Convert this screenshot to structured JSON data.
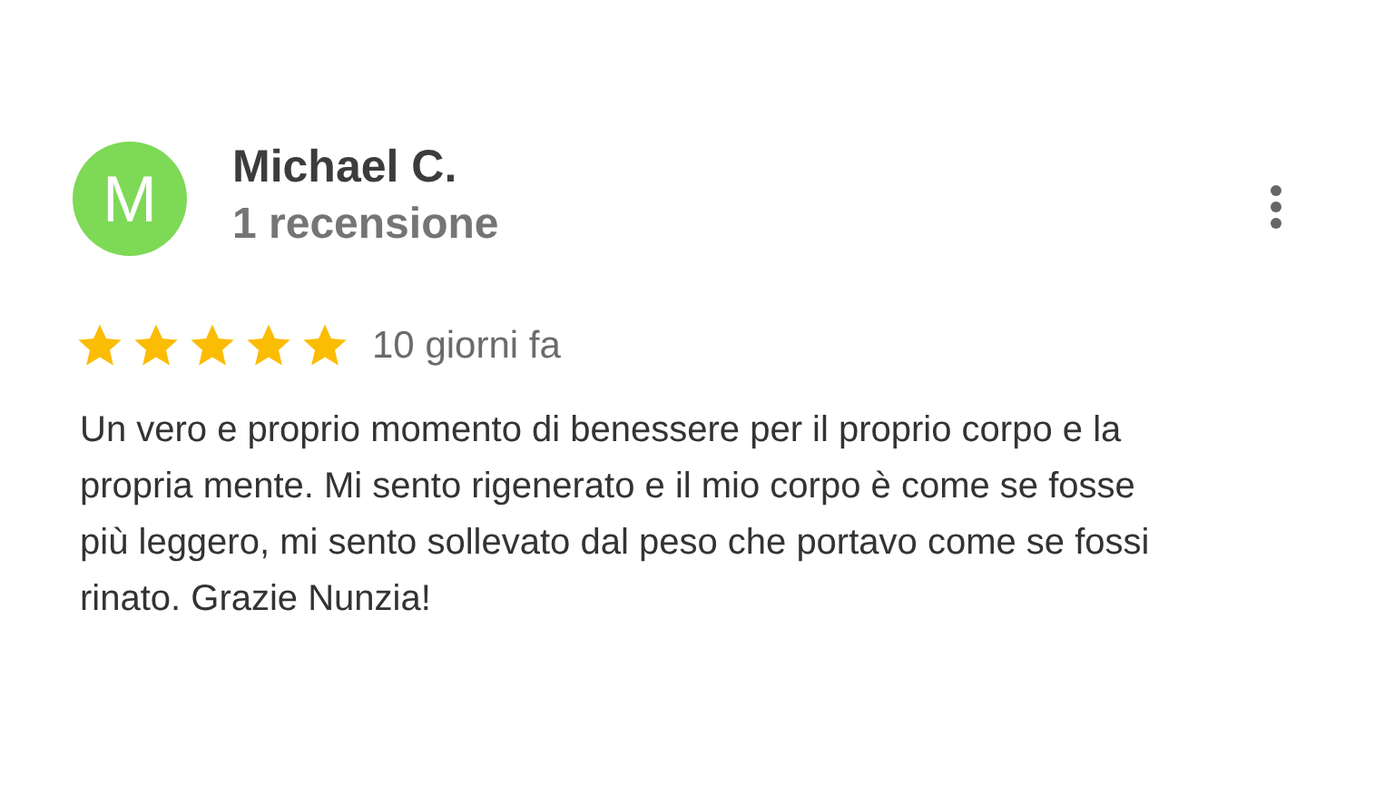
{
  "review": {
    "avatar": {
      "initial": "M",
      "color": "#7ed957"
    },
    "author": "Michael C.",
    "review_count": "1 recensione",
    "stars": 5,
    "date": "10 giorni fa",
    "text": "Un vero e proprio momento di benessere per il proprio corpo e la propria mente. Mi sento rigenerato e il mio corpo è come se fosse più leggero, mi sento sollevato dal peso che portavo come se fossi rinato. Grazie Nunzia!"
  }
}
